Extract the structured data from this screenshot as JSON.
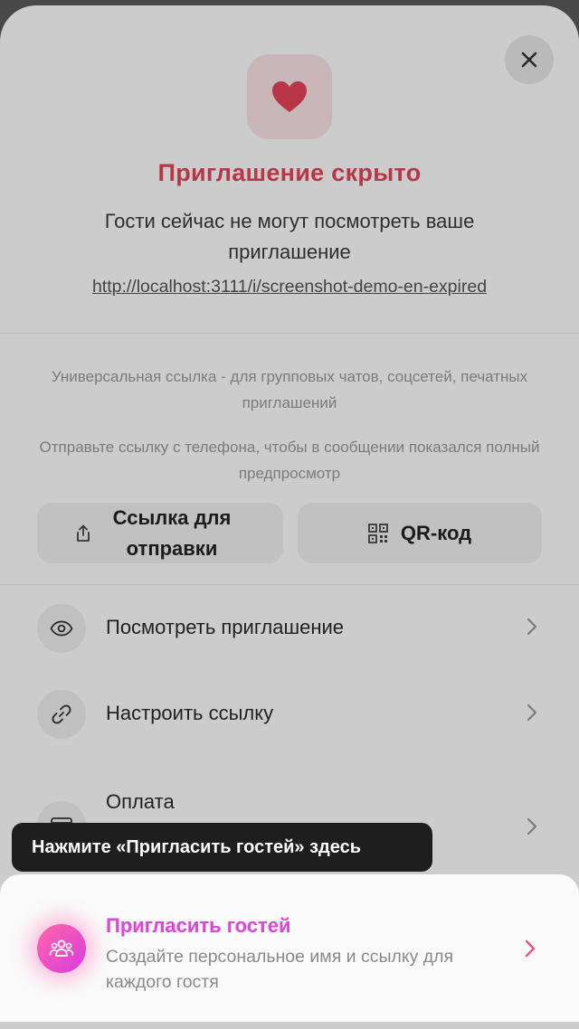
{
  "header": {
    "title": "Приглашение скрыто",
    "subtitle": "Гости сейчас не могут посмотреть ваше приглашение",
    "url": "http://localhost:3111/i/screenshot-demo-en-expired"
  },
  "share": {
    "hint_universal": "Универсальная ссылка - для групповых чатов, соцсетей, печатных приглашений",
    "hint_phone": "Отправьте ссылку с телефона, чтобы в сообщении показался полный предпросмотр",
    "send_link_label": "Ссылка для отправки",
    "qr_label": "QR-код"
  },
  "menu": {
    "items": [
      {
        "label": "Посмотреть приглашение",
        "icon": "eye-icon"
      },
      {
        "label": "Настроить ссылку",
        "icon": "link-icon"
      },
      {
        "label": "Оплата",
        "icon": "card-icon"
      }
    ]
  },
  "tooltip": {
    "text": "Нажмите «Пригласить гостей» здесь"
  },
  "invite": {
    "title": "Пригласить гостей",
    "description": "Создайте персональное имя и ссылку для каждого гостя",
    "icon": "guests-icon"
  },
  "colors": {
    "accent_red": "#e8445a",
    "accent_pink": "#f35ea4",
    "accent_purple": "#d93be0"
  }
}
